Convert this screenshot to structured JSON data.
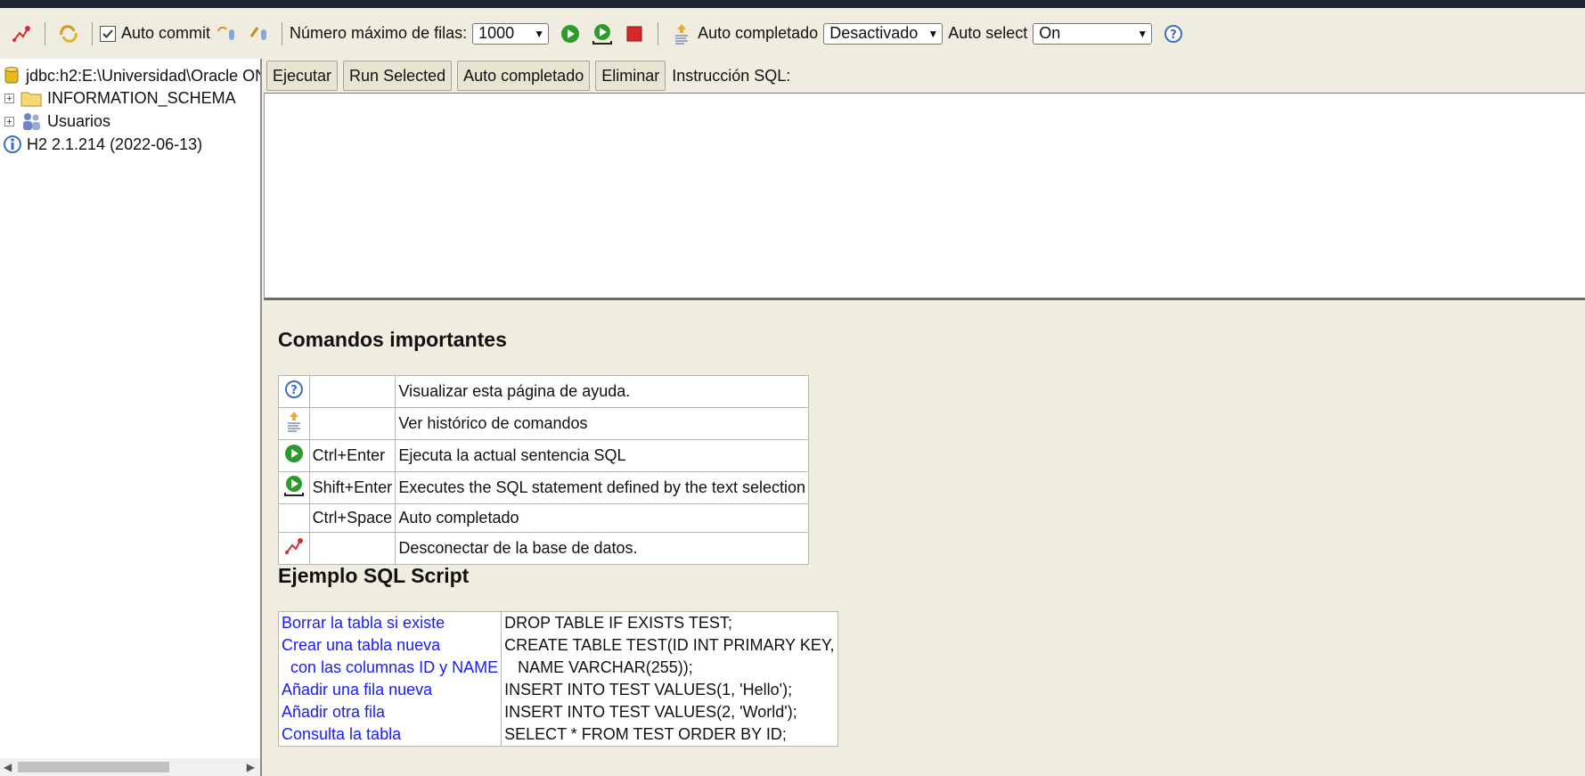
{
  "toolbar": {
    "auto_commit_label": "Auto commit",
    "max_rows_label": "Número máximo de filas:",
    "max_rows_value": "1000",
    "autocomplete_label": "Auto completado",
    "autocomplete_value": "Desactivado",
    "autoselect_label": "Auto select",
    "autoselect_value": "On"
  },
  "tree": {
    "connection": "jdbc:h2:E:\\Universidad\\Oracle ON",
    "items": [
      {
        "label": "INFORMATION_SCHEMA"
      },
      {
        "label": "Usuarios"
      }
    ],
    "version": "H2 2.1.214 (2022-06-13)"
  },
  "sql_bar": {
    "run": "Ejecutar",
    "run_selected": "Run Selected",
    "autocomplete": "Auto completado",
    "clear": "Eliminar",
    "statement_label": "Instrucción SQL:"
  },
  "help": {
    "title": "Comandos importantes",
    "commands": [
      {
        "icon": "help-icon",
        "shortcut": "",
        "description": "Visualizar esta página de ayuda."
      },
      {
        "icon": "history-icon",
        "shortcut": "",
        "description": "Ver histórico de comandos"
      },
      {
        "icon": "run-icon",
        "shortcut": "Ctrl+Enter",
        "description": "Ejecuta la actual sentencia SQL"
      },
      {
        "icon": "run-selected-icon",
        "shortcut": "Shift+Enter",
        "description": "Executes the SQL statement defined by the text selection"
      },
      {
        "icon": "",
        "shortcut": "Ctrl+Space",
        "description": "Auto completado"
      },
      {
        "icon": "disconnect-icon",
        "shortcut": "",
        "description": "Desconectar de la base de datos."
      }
    ],
    "example_title": "Ejemplo SQL Script",
    "example": [
      {
        "link": "Borrar la tabla si existe",
        "sql": "DROP TABLE IF EXISTS TEST;"
      },
      {
        "link": "Crear una tabla nueva",
        "sql": "CREATE TABLE TEST(ID INT PRIMARY KEY,"
      },
      {
        "link": "  con las columnas ID y NAME",
        "sql": "   NAME VARCHAR(255));"
      },
      {
        "link": "Añadir una fila nueva",
        "sql": "INSERT INTO TEST VALUES(1, 'Hello');"
      },
      {
        "link": "Añadir otra fila",
        "sql": "INSERT INTO TEST VALUES(2, 'World');"
      },
      {
        "link": "Consulta la tabla",
        "sql": "SELECT * FROM TEST ORDER BY ID;"
      }
    ]
  },
  "colors": {
    "accent_green": "#2e9a2e",
    "link_blue": "#1a1aff",
    "stop_red": "#d62828"
  }
}
